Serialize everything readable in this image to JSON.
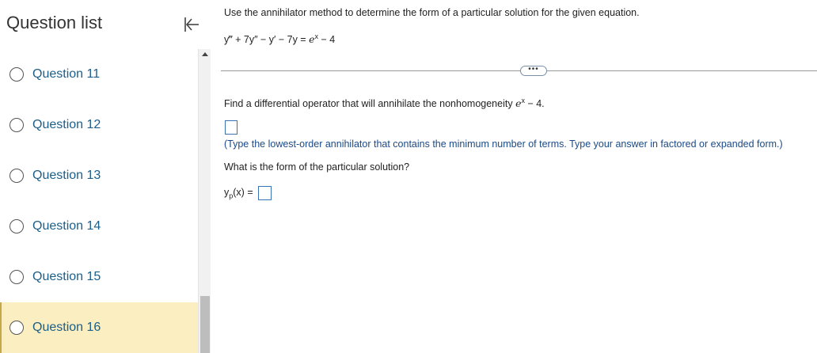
{
  "sidebar": {
    "title": "Question list",
    "collapse_icon": "collapse-left-icon",
    "items": [
      {
        "label": "Question 11",
        "selected": false
      },
      {
        "label": "Question 12",
        "selected": false
      },
      {
        "label": "Question 13",
        "selected": false
      },
      {
        "label": "Question 14",
        "selected": false
      },
      {
        "label": "Question 15",
        "selected": false
      },
      {
        "label": "Question 16",
        "selected": true
      }
    ]
  },
  "colors": {
    "selected_bg": "#fbeec0",
    "link": "#1a5e8a",
    "hint": "#1a4a88",
    "input_border": "#3a72b4"
  },
  "main": {
    "intro": "Use the annihilator method to determine the form of a particular solution for the given equation.",
    "equation_lhs": "y‴ + 7y″ − y′ − 7y = ",
    "equation_e": "e",
    "equation_exp": "x",
    "equation_tail": " − 4",
    "more_label": "•••",
    "find_text": "Find a differential operator that will annihilate the nonhomogeneity ",
    "find_e": "e",
    "find_exp": "x",
    "find_tail": " − 4.",
    "hint": "(Type the lowest-order annihilator that contains the minimum number of terms. Type your answer in factored or expanded form.)",
    "what_text": "What is the form of the particular solution?",
    "yp_main": "y",
    "yp_sub": "p",
    "yp_tail": "(x) = "
  }
}
